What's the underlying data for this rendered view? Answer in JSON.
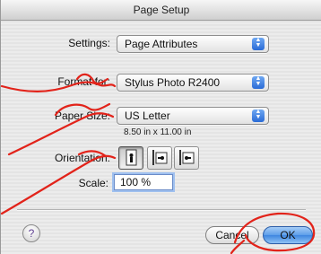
{
  "window": {
    "title": "Page Setup"
  },
  "settings": {
    "label": "Settings:",
    "value": "Page Attributes"
  },
  "format_for": {
    "label": "Format for:",
    "value": "Stylus Photo R2400"
  },
  "paper_size": {
    "label": "Paper Size:",
    "value": "US Letter",
    "dimensions": "8.50 in x 11.00 in"
  },
  "orientation": {
    "label": "Orientation:",
    "options": [
      {
        "name": "portrait",
        "selected": true
      },
      {
        "name": "landscape-left",
        "selected": false
      },
      {
        "name": "landscape-right",
        "selected": false
      }
    ]
  },
  "scale": {
    "label": "Scale:",
    "value": "100 %"
  },
  "buttons": {
    "help": "?",
    "cancel": "Cancel",
    "ok": "OK"
  },
  "icons": {
    "popup_arrows": "up-down-arrows-icon",
    "help": "help-icon"
  },
  "colors": {
    "annotation_red": "#e2231a",
    "default_button_blue": "#3e86e0",
    "popup_arrow_blue": "#2a6bd6"
  }
}
